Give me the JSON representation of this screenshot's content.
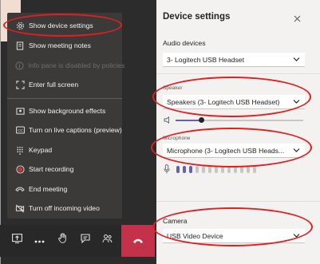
{
  "meeting_menu": {
    "items": [
      {
        "label": "Show device settings",
        "icon": "gear-icon",
        "disabled": false
      },
      {
        "label": "Show meeting notes",
        "icon": "notes-icon",
        "disabled": false
      },
      {
        "label": "Info pane is disabled by policies",
        "icon": "info-icon",
        "disabled": true
      },
      {
        "label": "Enter full screen",
        "icon": "fullscreen-icon",
        "disabled": false
      },
      {
        "label": "Show background effects",
        "icon": "background-effects-icon",
        "disabled": false
      },
      {
        "label": "Turn on live captions (preview)",
        "icon": "captions-icon",
        "disabled": false
      },
      {
        "label": "Keypad",
        "icon": "keypad-icon",
        "disabled": false
      },
      {
        "label": "Start recording",
        "icon": "record-icon",
        "disabled": false
      },
      {
        "label": "End meeting",
        "icon": "end-meeting-icon",
        "disabled": false
      },
      {
        "label": "Turn off incoming video",
        "icon": "video-off-icon",
        "disabled": false
      }
    ]
  },
  "toolbar": {
    "buttons": [
      "share-tray-icon",
      "more-actions-icon",
      "raise-hand-icon",
      "chat-icon",
      "participants-icon",
      "hang-up-icon"
    ]
  },
  "device_settings": {
    "title": "Device settings",
    "audio_devices": {
      "label": "Audio devices",
      "value": "3- Logitech USB Headset"
    },
    "speaker": {
      "label": "Speaker",
      "value": "Speakers (3- Logitech USB Headset)",
      "volume_fraction": 0.2
    },
    "microphone": {
      "label": "Microphone",
      "value": "Microphone (3- Logitech USB Heads...",
      "level_active_bars": 3,
      "level_total_bars": 13
    },
    "camera": {
      "label": "Camera",
      "value": "USB Video Device"
    }
  },
  "colors": {
    "annotation": "#e02020",
    "accent": "#6264a7",
    "hang_up": "#c4314b"
  }
}
